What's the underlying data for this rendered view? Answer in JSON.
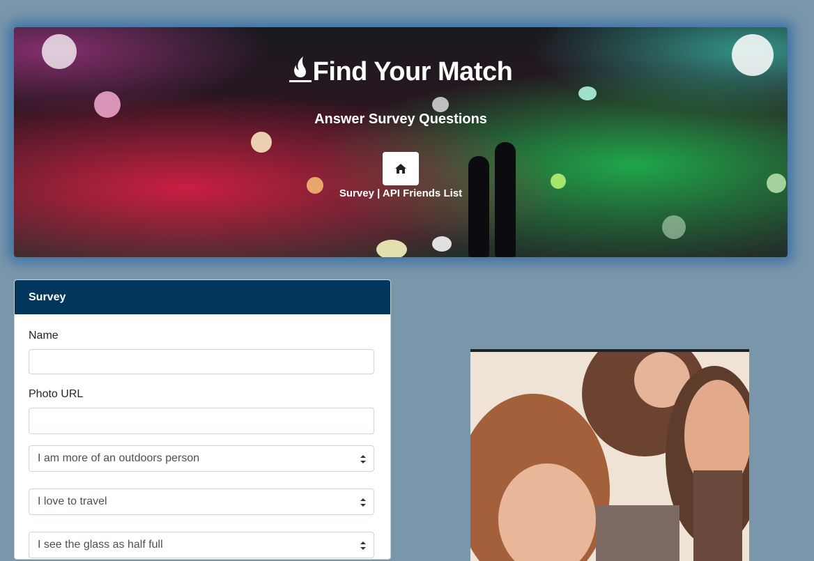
{
  "header": {
    "title": "Find Your Match",
    "subtitle": "Answer Survey Questions",
    "home_icon": "home-icon",
    "nav_links": [
      "Survey",
      "|",
      "API Friends List"
    ]
  },
  "survey": {
    "header": "Survey",
    "name_label": "Name",
    "photo_label": "Photo URL",
    "questions": [
      "I am more of an outdoors person",
      "I love to travel",
      "I see the glass as half full"
    ]
  },
  "colors": {
    "page_bg": "#7a96ab",
    "card_header": "#01375c",
    "glow": "#3f72a6"
  }
}
